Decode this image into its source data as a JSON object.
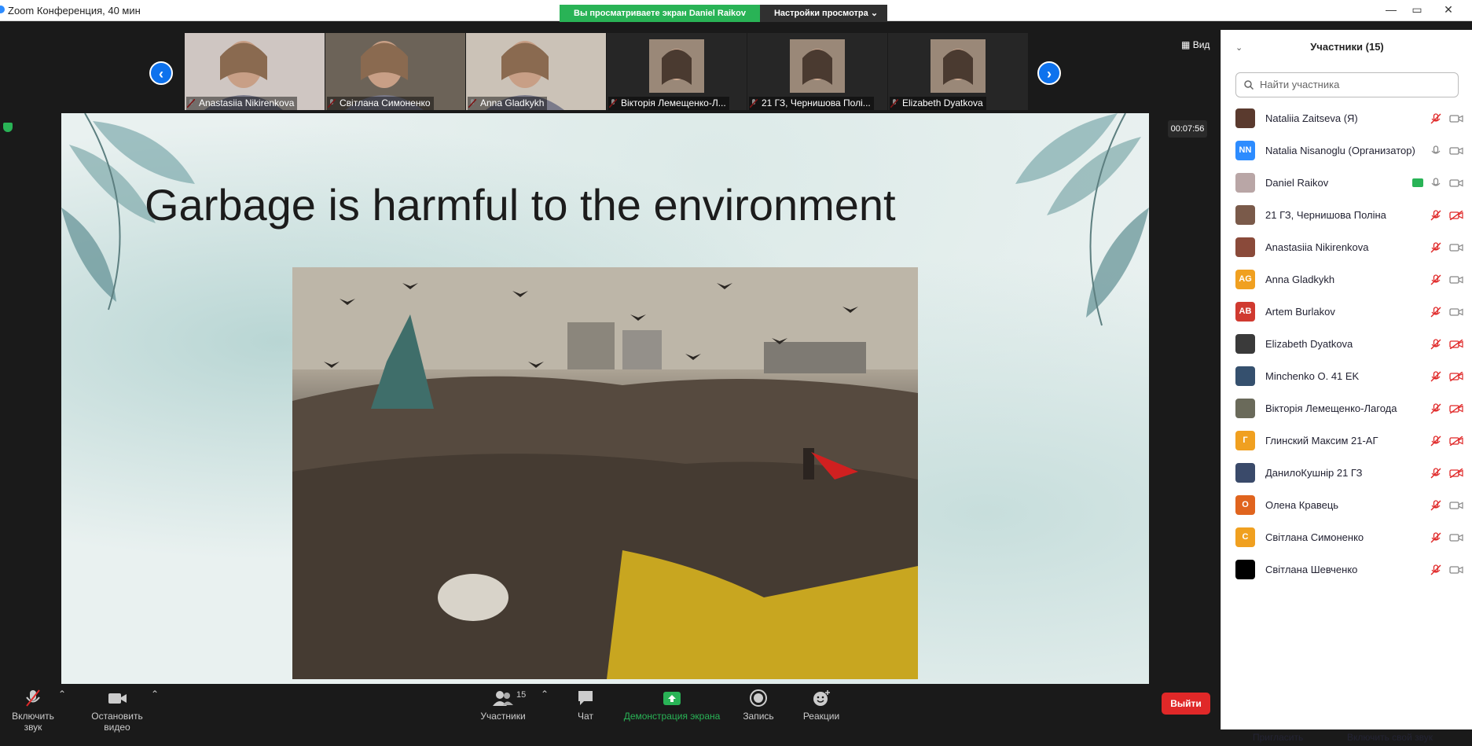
{
  "window": {
    "title": "Zoom Конференция, 40 мин",
    "minimize": "—",
    "restore": "▭",
    "close": "✕"
  },
  "share_banner": {
    "viewing": "Вы просматриваете экран Daniel Raikov",
    "view_options": "Настройки просмотра"
  },
  "gallery": {
    "view_label": "Вид",
    "prev": "‹",
    "next": "›",
    "thumbs": [
      {
        "name": "Anastasiia Nikirenkova",
        "bg": "#cfc6c2"
      },
      {
        "name": "Світлана Симоненко",
        "bg": "#6c6358"
      },
      {
        "name": "Anna Gladkykh",
        "bg": "#cbc2b7"
      },
      {
        "name": "Вікторія Лемещенко-Л...",
        "bg": "#262626"
      },
      {
        "name": "21 ГЗ, Чернишова Полі...",
        "bg": "#262626"
      },
      {
        "name": "Elizabeth Dyatkova",
        "bg": "#262626"
      }
    ]
  },
  "timer": "00:07:56",
  "slide": {
    "title": "Garbage is harmful to the environment"
  },
  "toolbar": {
    "unmute": "Включить звук",
    "stop_video": "Остановить видео",
    "participants": "Участники",
    "participants_count": "15",
    "chat": "Чат",
    "share_screen": "Демонстрация экрана",
    "record": "Запись",
    "reactions": "Реакции",
    "leave": "Выйти"
  },
  "panel": {
    "title": "Участники (15)",
    "search_placeholder": "Найти участника",
    "invite": "Пригласить",
    "unmute_me": "Включить свой звук",
    "participants": [
      {
        "name": "Nataliia Zaitseva (Я)",
        "avatar": "",
        "color": "#5a3a2e",
        "mic": "muted",
        "cam": "on"
      },
      {
        "name": "Natalia Nisanoglu (Организатор)",
        "avatar": "NN",
        "color": "#2d8cff",
        "mic": "on",
        "cam": "on"
      },
      {
        "name": "Daniel Raikov",
        "avatar": "",
        "color": "#b9a6a6",
        "mic": "on",
        "cam": "on",
        "sharing": true
      },
      {
        "name": "21 ГЗ, Чернишова Поліна",
        "avatar": "",
        "color": "#7a5a4a",
        "mic": "muted",
        "cam": "off"
      },
      {
        "name": "Anastasiia Nikirenkova",
        "avatar": "",
        "color": "#8a4a3a",
        "mic": "muted",
        "cam": "on"
      },
      {
        "name": "Anna Gladkykh",
        "avatar": "AG",
        "color": "#f0a020",
        "mic": "muted",
        "cam": "on"
      },
      {
        "name": "Artem Burlakov",
        "avatar": "AB",
        "color": "#d03a30",
        "mic": "muted",
        "cam": "on"
      },
      {
        "name": "Elizabeth Dyatkova",
        "avatar": "",
        "color": "#3a3a3a",
        "mic": "muted",
        "cam": "off"
      },
      {
        "name": "Minchenko O. 41 EK",
        "avatar": "",
        "color": "#35506e",
        "mic": "muted",
        "cam": "off"
      },
      {
        "name": "Вікторія Лемещенко-Лагода",
        "avatar": "",
        "color": "#6a6a5a",
        "mic": "muted",
        "cam": "off"
      },
      {
        "name": "Глинский Максим 21-АГ",
        "avatar": "Г",
        "color": "#f0a020",
        "mic": "muted",
        "cam": "off"
      },
      {
        "name": "ДанилоКушнір 21 ГЗ",
        "avatar": "",
        "color": "#3a4a6a",
        "mic": "muted",
        "cam": "off"
      },
      {
        "name": "Олена Кравець",
        "avatar": "О",
        "color": "#e0641e",
        "mic": "muted",
        "cam": "on"
      },
      {
        "name": "Світлана Симоненко",
        "avatar": "С",
        "color": "#f0a020",
        "mic": "muted",
        "cam": "on"
      },
      {
        "name": "Світлана Шевченко",
        "avatar": "",
        "color": "#000000",
        "mic": "muted",
        "cam": "on"
      }
    ]
  },
  "colors": {
    "accent": "#0e72ed",
    "share_green": "#29b356",
    "leave_red": "#e02828",
    "muted_red": "#e02828"
  }
}
